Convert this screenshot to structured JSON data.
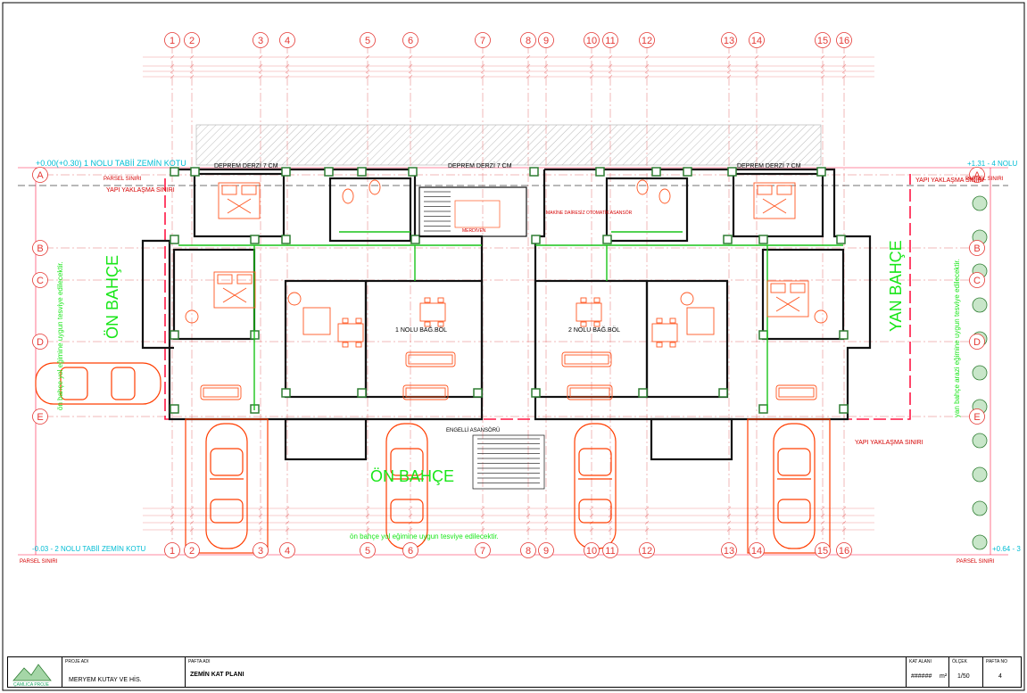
{
  "plan": {
    "grid_columns": [
      "1",
      "2",
      "3",
      "4",
      "5",
      "6",
      "7",
      "8",
      "9",
      "10",
      "11",
      "12",
      "13",
      "14",
      "15",
      "16"
    ],
    "grid_rows": [
      "A",
      "B",
      "C",
      "D",
      "E"
    ],
    "top_expansion_joint_left": "DEPREM DERZİ 7 CM",
    "top_expansion_joint_center": "DEPREM DERZİ 7 CM",
    "top_expansion_joint_right": "DEPREM DERZİ 7 CM",
    "level_top_left": "+0.00(+0.30) 1 NOLU TABİİ ZEMİN KOTU",
    "level_top_right": "+1.31 - 4 NOLU",
    "level_bottom_left": "-0.03 - 2 NOLU TABİİ ZEMİN KOTU",
    "level_bottom_right": "+0.64 - 3",
    "parsel_label": "PARSEL SINIRI",
    "setback_label": "YAPI YAKLAŞMA SINIRI",
    "front_garden_left": "ÖN BAHÇE",
    "front_garden_bottom": "ÖN BAHÇE",
    "side_garden": "YAN BAHÇE",
    "left_note": "ön bahçe yol eğimine uygun tesviye edilecektir.",
    "bottom_note": "ön bahçe yol eğimine uygun tesviye edilecektir.",
    "right_note": "yan bahçe arazi eğimine uygun tesviye edilecektir.",
    "unit_1": "1 NOLU BAĞ.BÖL",
    "unit_2": "2 NOLU BAĞ.BÖL",
    "lift_label": "ENGELLİ ASANSÖRÜ",
    "stair_label": "MERDİVEN",
    "machine_lift": "MAKİNE DAİRESİZ OTOMATİK ASANSÖR"
  },
  "title_block": {
    "project_label": "PROJE ADI",
    "owner": "MERYEM KUTAY VE HİS.",
    "sheet_label": "PAFTA ADI",
    "sheet_name": "ZEMİN KAT PLANI",
    "area_label": "KAT ALANI",
    "area_value": "######",
    "area_unit": "m²",
    "scale_label": "ÖLÇEK",
    "scale_value": "1/50",
    "sheet_no_label": "PAFTA NO",
    "sheet_no_value": "4",
    "logo_text": "ÇAMLICA PROJE"
  },
  "colors": {
    "grid": "#e53935",
    "wall": "#111111",
    "structure": "#2e7d32",
    "setback": "#ff1744",
    "dim": "#ef9a9a",
    "furniture": "#ff5722",
    "cyan": "#00bcd4",
    "garden_text": "#19e619",
    "blue": "#1e3ad1"
  }
}
